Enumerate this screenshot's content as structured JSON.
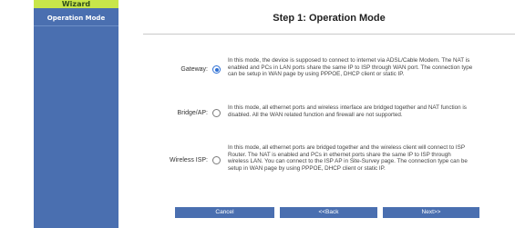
{
  "sidebar": {
    "header": "Wizard",
    "items": [
      {
        "label": "Operation Mode"
      }
    ]
  },
  "main": {
    "title": "Step 1: Operation Mode",
    "options": [
      {
        "label": "Gateway:",
        "selected": true,
        "description": "In this mode, the device is supposed to connect to internet via ADSL/Cable Modem. The NAT is\nenabled and PCs in LAN ports share the same IP to ISP through WAN port. The connection type\ncan be setup in WAN page by using PPPOE, DHCP client or static IP."
      },
      {
        "label": "Bridge/AP:",
        "selected": false,
        "description": "In this mode, all ethernet ports and wireless interface are bridged together and NAT function is\ndisabled. All the WAN related function and firewall are not supported."
      },
      {
        "label": "Wireless ISP:",
        "selected": false,
        "description": "In this mode, all ethernet ports are bridged together and the wireless client will connect to ISP\nRouter. The NAT is enabled and PCs in ethernet ports share the same IP to ISP through\nwireless LAN. You can connect to the ISP AP in Site-Survey page. The connection type can be\nsetup in WAN page by using PPPOE, DHCP client or static IP."
      }
    ],
    "buttons": {
      "cancel": "Cancel",
      "back": "<<Back",
      "next": "Next>>"
    }
  },
  "colors": {
    "sidebar": "#4a6fb0",
    "wizard_header": "#c8e64a",
    "radio_selected": "#2d6fd4",
    "button": "#4a6fb0"
  }
}
